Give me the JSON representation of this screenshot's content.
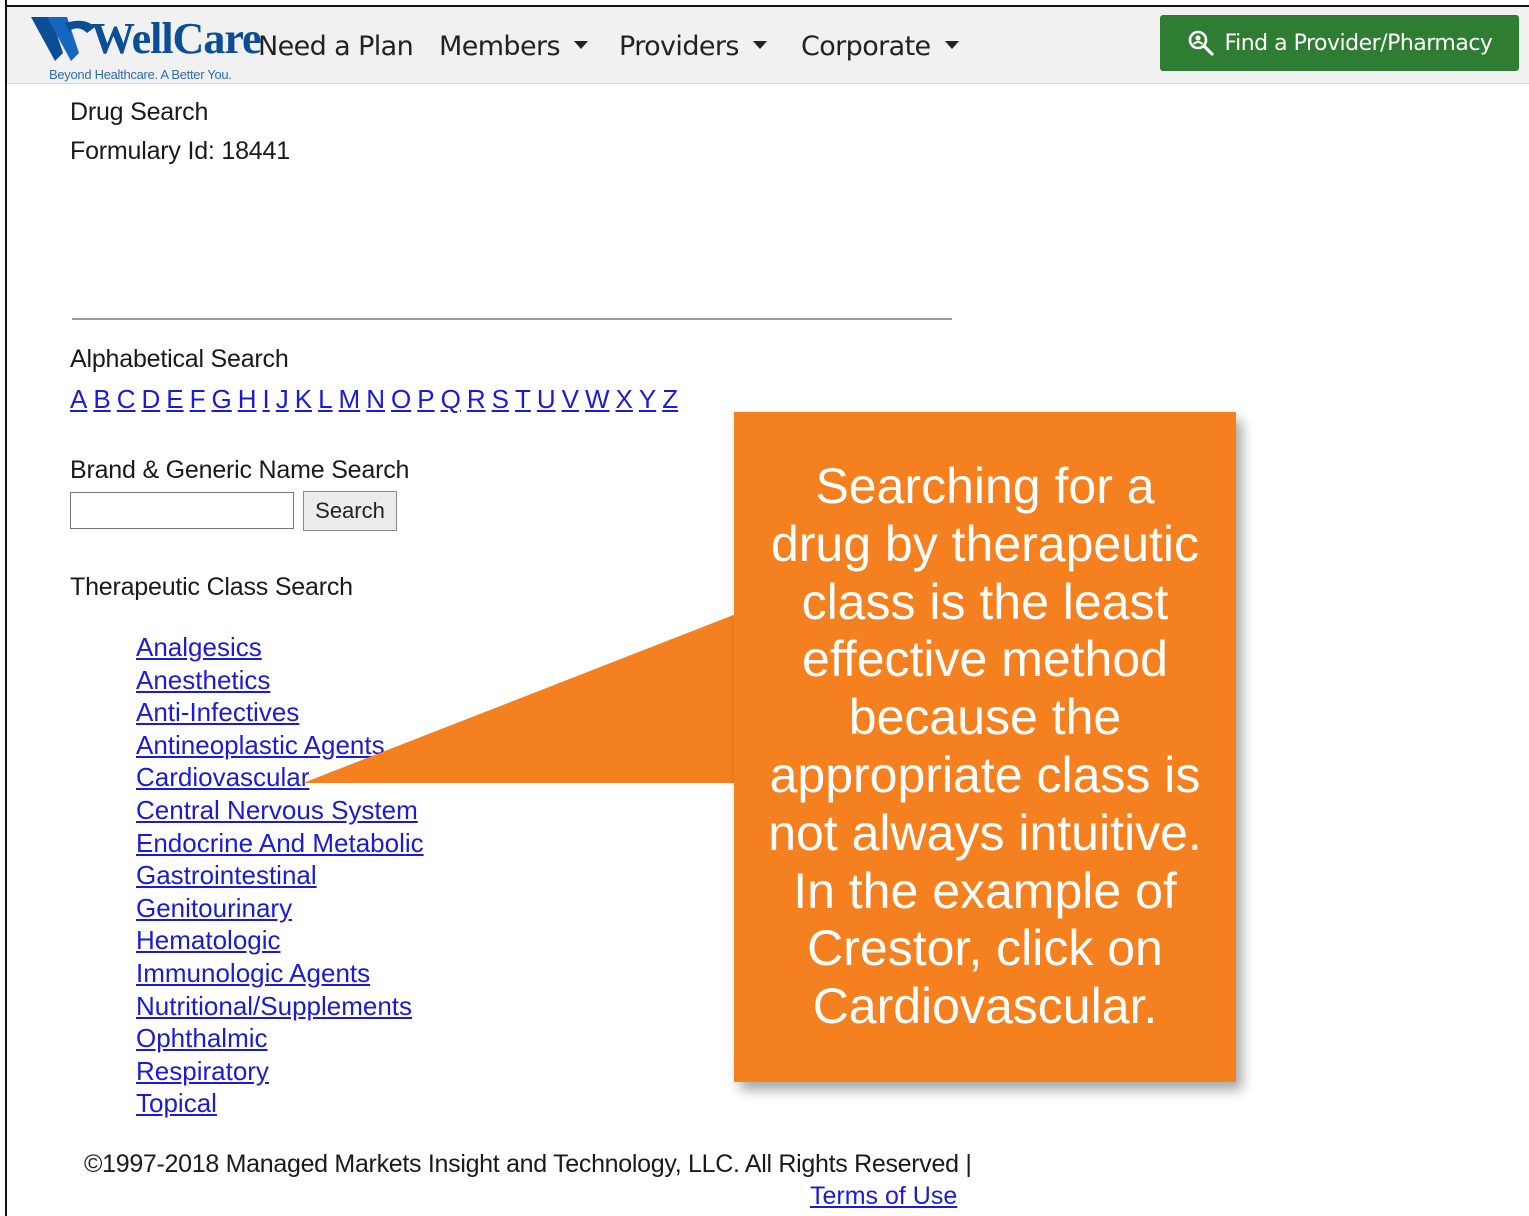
{
  "header": {
    "logo_word": "WellCare",
    "logo_tagline": "Beyond Healthcare. A Better You.",
    "nav": [
      {
        "label": "Need a Plan",
        "has_menu": false
      },
      {
        "label": "Members",
        "has_menu": true
      },
      {
        "label": "Providers",
        "has_menu": true
      },
      {
        "label": "Corporate",
        "has_menu": true
      }
    ],
    "find_button": {
      "label": "Find a Provider/Pharmacy",
      "icon": "search-icon"
    },
    "brand_color": "#0b4e96",
    "button_color": "#2e7d32"
  },
  "page": {
    "title": "Drug Search",
    "formulary": "Formulary Id: 18441"
  },
  "alphabetical": {
    "heading": "Alphabetical Search",
    "letters": [
      "A",
      "B",
      "C",
      "D",
      "E",
      "F",
      "G",
      "H",
      "I",
      "J",
      "K",
      "L",
      "M",
      "N",
      "O",
      "P",
      "Q",
      "R",
      "S",
      "T",
      "U",
      "V",
      "W",
      "X",
      "Y",
      "Z"
    ]
  },
  "name_search": {
    "heading": "Brand & Generic Name Search",
    "input_value": "",
    "button_label": "Search"
  },
  "therapeutic": {
    "heading": "Therapeutic Class Search",
    "classes": [
      "Analgesics",
      "Anesthetics",
      "Anti-Infectives",
      "Antineoplastic Agents",
      "Cardiovascular",
      "Central Nervous System",
      "Endocrine And Metabolic",
      "Gastrointestinal",
      "Genitourinary",
      "Hematologic",
      "Immunologic Agents",
      "Nutritional/Supplements",
      "Ophthalmic",
      "Respiratory",
      "Topical"
    ]
  },
  "footer": {
    "copyright": "©1997-2018 Managed Markets Insight and Technology, LLC. All Rights Reserved |",
    "terms": "Terms of Use"
  },
  "callout": {
    "lines": [
      "Searching for a",
      "drug by therapeutic",
      "class is the least",
      "effective method",
      "because the",
      "appropriate class is",
      "not always intuitive.",
      "In the example of",
      "Crestor, click on",
      "Cardiovascular."
    ],
    "color": "#f5801f"
  }
}
